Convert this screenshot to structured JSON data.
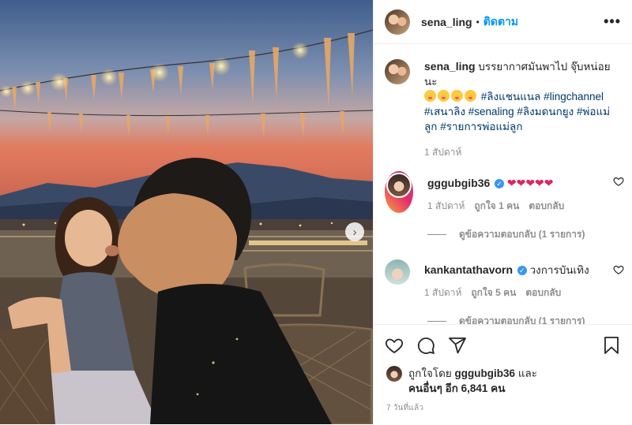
{
  "post": {
    "username": "sena_ling",
    "follow_label": "ติดตาม",
    "more_label": "•••",
    "caption": {
      "text": "บรรยากาศมันพาไป จุ๊บหน่อยนะ",
      "hashtags_line1": "#ลิงแชนแนล #lingchannel",
      "hashtags_line2": "#เสนาลิง #senaling #ลิงมดนกยูง #พ่อแม่ลูก #รายการพ่อแม่ลูก",
      "time": "1 สัปดาห์"
    }
  },
  "comments": [
    {
      "username": "gggubgib36",
      "text": "",
      "time": "1 สัปดาห์",
      "likes": "ถูกใจ 1 คน",
      "reply_label": "ตอบกลับ",
      "view_replies": "ดูข้อความตอบกลับ (1 รายการ)"
    },
    {
      "username": "kankantathavorn",
      "text": "วงการบันเทิง",
      "time": "1 สัปดาห์",
      "likes": "ถูกใจ 5 คน",
      "reply_label": "ตอบกลับ",
      "view_replies": "ดูข้อความตอบกลับ (1 รายการ)"
    }
  ],
  "likes_summary": {
    "prefix": "ถูกใจโดย",
    "user": "gggubgib36",
    "conj": "และ",
    "others": "คนอื่นๆ อีก 6,841 คน"
  },
  "timestamp": "7 วันที่แล้ว",
  "icons": {
    "like": "heart-icon",
    "comment": "comment-icon",
    "share": "paper-plane-icon",
    "save": "bookmark-icon",
    "next": "chevron-right-icon"
  },
  "colors": {
    "link_blue": "#0095f6",
    "hashtag": "#00376b",
    "muted": "#8e8e8e",
    "heart_red": "#e0245e"
  }
}
